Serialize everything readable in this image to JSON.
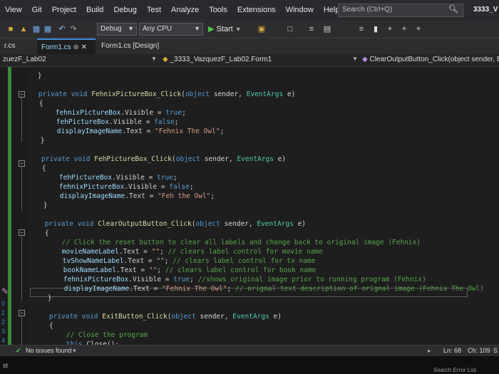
{
  "menu": [
    "View",
    "Git",
    "Project",
    "Build",
    "Debug",
    "Test",
    "Analyze",
    "Tools",
    "Extensions",
    "Window",
    "Help"
  ],
  "search_placeholder": "Search (Ctrl+Q)",
  "solution_name": "3333_V",
  "toolbar": {
    "config": "Debug",
    "platform": "Any CPU",
    "start": "Start"
  },
  "tabs": {
    "left": "r.cs",
    "active": "Form1.cs",
    "designer": "Form1.cs [Design]"
  },
  "navbar": {
    "project": "zuezF_Lab02",
    "class": "_3333_VazquezF_Lab02.Form1",
    "member": "ClearOutputButton_Click(object sender, Even"
  },
  "code_lines": [
    [
      [
        "p",
        "    }"
      ]
    ],
    [],
    [
      [
        "k",
        "    private void "
      ],
      [
        "m",
        "FehnixPictureBox_Click"
      ],
      [
        "p",
        "("
      ],
      [
        "k",
        "object"
      ],
      [
        "p",
        " sender, "
      ],
      [
        "t",
        "EventArgs"
      ],
      [
        "p",
        " e)"
      ]
    ],
    [
      [
        "p",
        "    {"
      ]
    ],
    [
      [
        "v",
        "        fehnixPictureBox"
      ],
      [
        "p",
        ".Visible = "
      ],
      [
        "k",
        "true"
      ],
      [
        "p",
        ";"
      ]
    ],
    [
      [
        "v",
        "        fehPictureBox"
      ],
      [
        "p",
        ".Visible = "
      ],
      [
        "k",
        "false"
      ],
      [
        "p",
        ";"
      ]
    ],
    [
      [
        "v",
        "        displayImageName"
      ],
      [
        "p",
        ".Text = "
      ],
      [
        "s",
        "\"Fehnix The Owl\""
      ],
      [
        "p",
        ";"
      ]
    ],
    [
      [
        "p",
        "    }"
      ]
    ],
    [],
    [
      [
        "k",
        "    private void "
      ],
      [
        "m",
        "FehPictureBox_Click"
      ],
      [
        "p",
        "("
      ],
      [
        "k",
        "object"
      ],
      [
        "p",
        " sender, "
      ],
      [
        "t",
        "EventArgs"
      ],
      [
        "p",
        " e)"
      ]
    ],
    [
      [
        "p",
        "    {"
      ]
    ],
    [
      [
        "v",
        "        fehPictureBox"
      ],
      [
        "p",
        ".Visible = "
      ],
      [
        "k",
        "true"
      ],
      [
        "p",
        ";"
      ]
    ],
    [
      [
        "v",
        "        fehnixPictureBox"
      ],
      [
        "p",
        ".Visible = "
      ],
      [
        "k",
        "false"
      ],
      [
        "p",
        ";"
      ]
    ],
    [
      [
        "v",
        "        displayImageName"
      ],
      [
        "p",
        ".Text = "
      ],
      [
        "s",
        "\"Feh the Owl\""
      ],
      [
        "p",
        ";"
      ]
    ],
    [
      [
        "p",
        "    }"
      ]
    ],
    [],
    [
      [
        "k",
        "    private void "
      ],
      [
        "m",
        "ClearOutputButton_Click"
      ],
      [
        "p",
        "("
      ],
      [
        "k",
        "object"
      ],
      [
        "p",
        " sender, "
      ],
      [
        "t",
        "EventArgs"
      ],
      [
        "p",
        " e)"
      ]
    ],
    [
      [
        "p",
        "    {"
      ]
    ],
    [
      [
        "c",
        "        // Click the reset button to clear all labels and change back to original image (Fehnix)"
      ]
    ],
    [
      [
        "v",
        "        movieNameLabel"
      ],
      [
        "p",
        ".Text = "
      ],
      [
        "s",
        "\"\""
      ],
      [
        "p",
        "; "
      ],
      [
        "c",
        "// clears label control for movie name"
      ]
    ],
    [
      [
        "v",
        "        tvShowNameLabel"
      ],
      [
        "p",
        ".Text = "
      ],
      [
        "s",
        "\"\""
      ],
      [
        "p",
        "; "
      ],
      [
        "c",
        "// clears label control for tv name"
      ]
    ],
    [
      [
        "v",
        "        bookNameLabel"
      ],
      [
        "p",
        ".Text = "
      ],
      [
        "s",
        "\"\""
      ],
      [
        "p",
        "; "
      ],
      [
        "c",
        "// clears label control for book name"
      ]
    ],
    [
      [
        "v",
        "        fehnixPictureBox"
      ],
      [
        "p",
        ".Visible = "
      ],
      [
        "k",
        "true"
      ],
      [
        "p",
        "; "
      ],
      [
        "c",
        "//shows original image prior to running program (Fehnix)"
      ]
    ],
    [
      [
        "v",
        "        displayImageName"
      ],
      [
        "p",
        ".Text = "
      ],
      [
        "s",
        "\"Fehnix The Owl\""
      ],
      [
        "p",
        "; "
      ],
      [
        "c",
        "// orignal text description of orignal image (Fehnix The Owl)"
      ]
    ],
    [
      [
        "p",
        "    }"
      ]
    ],
    [],
    [
      [
        "k",
        "    private void "
      ],
      [
        "m",
        "ExitButton_Click"
      ],
      [
        "p",
        "("
      ],
      [
        "k",
        "object"
      ],
      [
        "p",
        " sender, "
      ],
      [
        "t",
        "EventArgs"
      ],
      [
        "p",
        " e)"
      ]
    ],
    [
      [
        "p",
        "    {"
      ]
    ],
    [
      [
        "c",
        "        // Close the program"
      ]
    ],
    [
      [
        "k",
        "        this"
      ],
      [
        "p",
        ".Close();"
      ]
    ]
  ],
  "line_numbers": [
    "0",
    "1",
    "2",
    "3",
    "4"
  ],
  "status": {
    "issues": "No issues found",
    "line": "Ln: 68",
    "col": "Ch: 109",
    "mode": "S"
  },
  "bottom": {
    "left": "st",
    "right": "Search Error List"
  }
}
